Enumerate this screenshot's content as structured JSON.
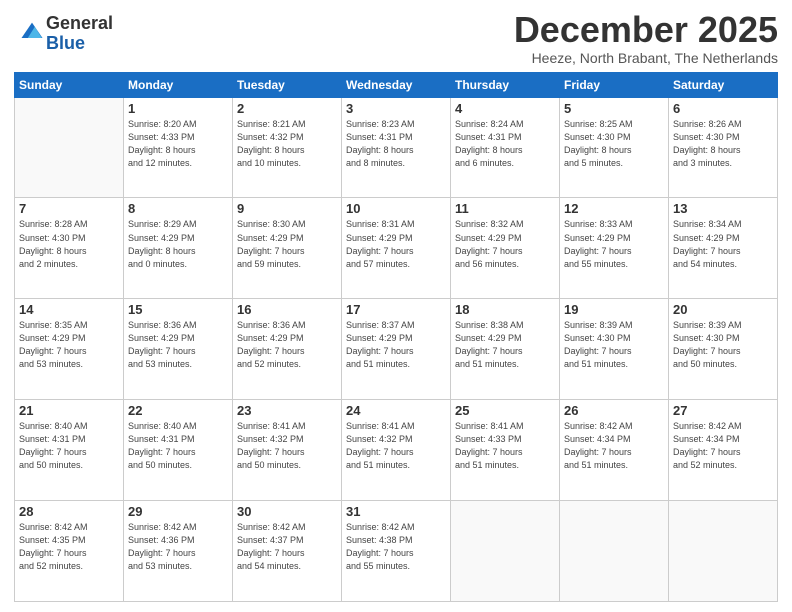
{
  "logo": {
    "general": "General",
    "blue": "Blue"
  },
  "title": "December 2025",
  "location": "Heeze, North Brabant, The Netherlands",
  "days_of_week": [
    "Sunday",
    "Monday",
    "Tuesday",
    "Wednesday",
    "Thursday",
    "Friday",
    "Saturday"
  ],
  "weeks": [
    [
      {
        "day": "",
        "info": ""
      },
      {
        "day": "1",
        "info": "Sunrise: 8:20 AM\nSunset: 4:33 PM\nDaylight: 8 hours\nand 12 minutes."
      },
      {
        "day": "2",
        "info": "Sunrise: 8:21 AM\nSunset: 4:32 PM\nDaylight: 8 hours\nand 10 minutes."
      },
      {
        "day": "3",
        "info": "Sunrise: 8:23 AM\nSunset: 4:31 PM\nDaylight: 8 hours\nand 8 minutes."
      },
      {
        "day": "4",
        "info": "Sunrise: 8:24 AM\nSunset: 4:31 PM\nDaylight: 8 hours\nand 6 minutes."
      },
      {
        "day": "5",
        "info": "Sunrise: 8:25 AM\nSunset: 4:30 PM\nDaylight: 8 hours\nand 5 minutes."
      },
      {
        "day": "6",
        "info": "Sunrise: 8:26 AM\nSunset: 4:30 PM\nDaylight: 8 hours\nand 3 minutes."
      }
    ],
    [
      {
        "day": "7",
        "info": "Sunrise: 8:28 AM\nSunset: 4:30 PM\nDaylight: 8 hours\nand 2 minutes."
      },
      {
        "day": "8",
        "info": "Sunrise: 8:29 AM\nSunset: 4:29 PM\nDaylight: 8 hours\nand 0 minutes."
      },
      {
        "day": "9",
        "info": "Sunrise: 8:30 AM\nSunset: 4:29 PM\nDaylight: 7 hours\nand 59 minutes."
      },
      {
        "day": "10",
        "info": "Sunrise: 8:31 AM\nSunset: 4:29 PM\nDaylight: 7 hours\nand 57 minutes."
      },
      {
        "day": "11",
        "info": "Sunrise: 8:32 AM\nSunset: 4:29 PM\nDaylight: 7 hours\nand 56 minutes."
      },
      {
        "day": "12",
        "info": "Sunrise: 8:33 AM\nSunset: 4:29 PM\nDaylight: 7 hours\nand 55 minutes."
      },
      {
        "day": "13",
        "info": "Sunrise: 8:34 AM\nSunset: 4:29 PM\nDaylight: 7 hours\nand 54 minutes."
      }
    ],
    [
      {
        "day": "14",
        "info": "Sunrise: 8:35 AM\nSunset: 4:29 PM\nDaylight: 7 hours\nand 53 minutes."
      },
      {
        "day": "15",
        "info": "Sunrise: 8:36 AM\nSunset: 4:29 PM\nDaylight: 7 hours\nand 53 minutes."
      },
      {
        "day": "16",
        "info": "Sunrise: 8:36 AM\nSunset: 4:29 PM\nDaylight: 7 hours\nand 52 minutes."
      },
      {
        "day": "17",
        "info": "Sunrise: 8:37 AM\nSunset: 4:29 PM\nDaylight: 7 hours\nand 51 minutes."
      },
      {
        "day": "18",
        "info": "Sunrise: 8:38 AM\nSunset: 4:29 PM\nDaylight: 7 hours\nand 51 minutes."
      },
      {
        "day": "19",
        "info": "Sunrise: 8:39 AM\nSunset: 4:30 PM\nDaylight: 7 hours\nand 51 minutes."
      },
      {
        "day": "20",
        "info": "Sunrise: 8:39 AM\nSunset: 4:30 PM\nDaylight: 7 hours\nand 50 minutes."
      }
    ],
    [
      {
        "day": "21",
        "info": "Sunrise: 8:40 AM\nSunset: 4:31 PM\nDaylight: 7 hours\nand 50 minutes."
      },
      {
        "day": "22",
        "info": "Sunrise: 8:40 AM\nSunset: 4:31 PM\nDaylight: 7 hours\nand 50 minutes."
      },
      {
        "day": "23",
        "info": "Sunrise: 8:41 AM\nSunset: 4:32 PM\nDaylight: 7 hours\nand 50 minutes."
      },
      {
        "day": "24",
        "info": "Sunrise: 8:41 AM\nSunset: 4:32 PM\nDaylight: 7 hours\nand 51 minutes."
      },
      {
        "day": "25",
        "info": "Sunrise: 8:41 AM\nSunset: 4:33 PM\nDaylight: 7 hours\nand 51 minutes."
      },
      {
        "day": "26",
        "info": "Sunrise: 8:42 AM\nSunset: 4:34 PM\nDaylight: 7 hours\nand 51 minutes."
      },
      {
        "day": "27",
        "info": "Sunrise: 8:42 AM\nSunset: 4:34 PM\nDaylight: 7 hours\nand 52 minutes."
      }
    ],
    [
      {
        "day": "28",
        "info": "Sunrise: 8:42 AM\nSunset: 4:35 PM\nDaylight: 7 hours\nand 52 minutes."
      },
      {
        "day": "29",
        "info": "Sunrise: 8:42 AM\nSunset: 4:36 PM\nDaylight: 7 hours\nand 53 minutes."
      },
      {
        "day": "30",
        "info": "Sunrise: 8:42 AM\nSunset: 4:37 PM\nDaylight: 7 hours\nand 54 minutes."
      },
      {
        "day": "31",
        "info": "Sunrise: 8:42 AM\nSunset: 4:38 PM\nDaylight: 7 hours\nand 55 minutes."
      },
      {
        "day": "",
        "info": ""
      },
      {
        "day": "",
        "info": ""
      },
      {
        "day": "",
        "info": ""
      }
    ]
  ]
}
